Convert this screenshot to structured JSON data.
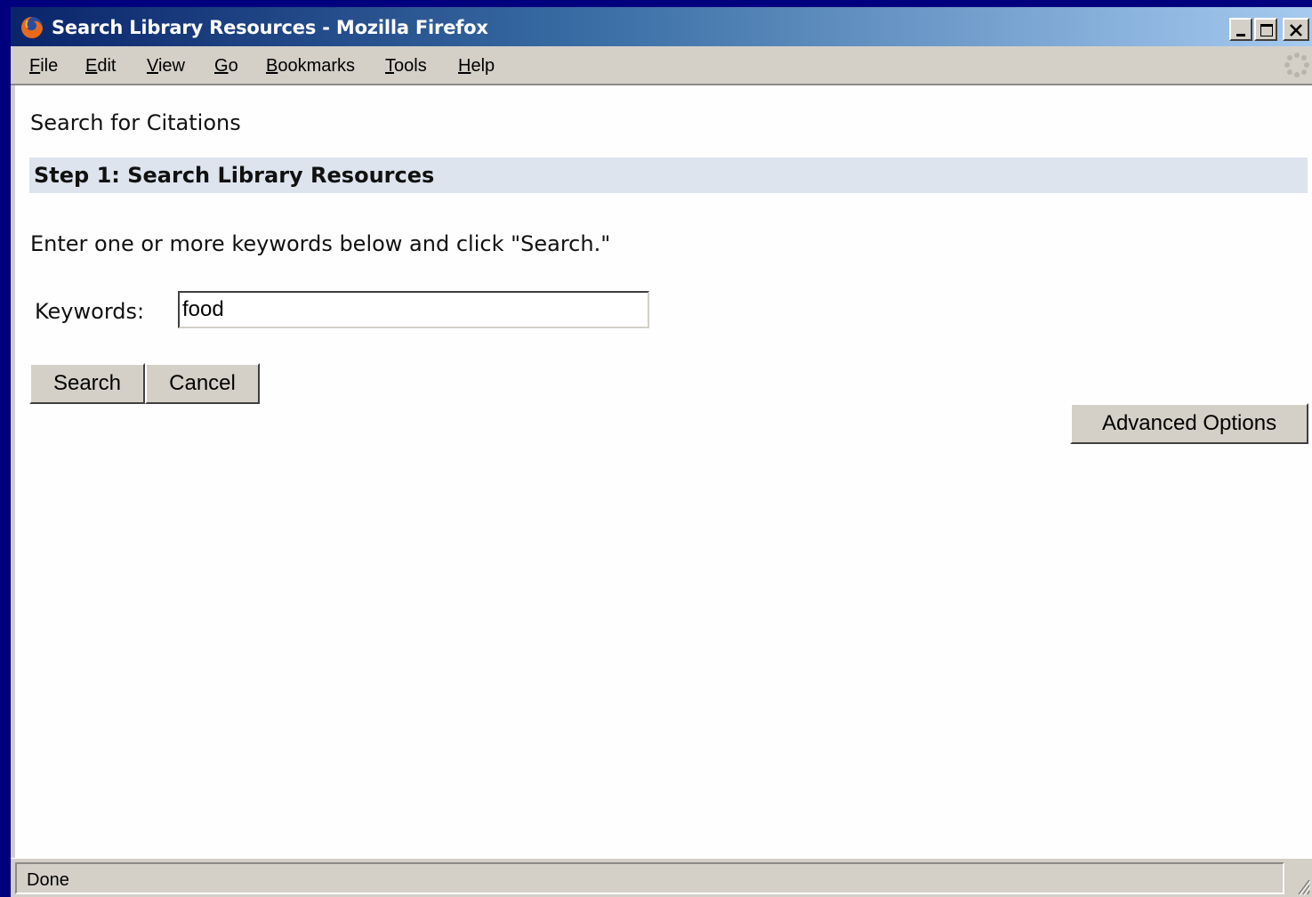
{
  "window": {
    "title": "Search Library Resources - Mozilla Firefox",
    "controls": [
      "minimize-icon",
      "maximize-icon",
      "close-icon"
    ]
  },
  "menu": {
    "items": [
      {
        "accel": "F",
        "rest": "ile"
      },
      {
        "accel": "E",
        "rest": "dit"
      },
      {
        "accel": "V",
        "rest": "iew"
      },
      {
        "accel": "G",
        "rest": "o"
      },
      {
        "accel": "B",
        "rest": "ookmarks"
      },
      {
        "accel": "T",
        "rest": "ools"
      },
      {
        "accel": "H",
        "rest": "elp"
      }
    ]
  },
  "page": {
    "title": "Search for Citations",
    "step_heading": "Step 1: Search Library Resources",
    "instructions": "Enter one or more keywords below and click \"Search.\"",
    "keywords_label": "Keywords:",
    "keywords_value": "food",
    "search_label": "Search",
    "cancel_label": "Cancel",
    "advanced_label": "Advanced Options"
  },
  "status": {
    "text": "Done"
  },
  "colors": {
    "desktop": "#00007e",
    "titlebar_start": "#0a246a",
    "titlebar_end": "#a6caf0",
    "step_header_bg": "#dde4ee",
    "chrome": "#d4d0c8"
  },
  "icons": [
    "firefox-icon",
    "throbber-icon",
    "resize-grip-icon"
  ]
}
